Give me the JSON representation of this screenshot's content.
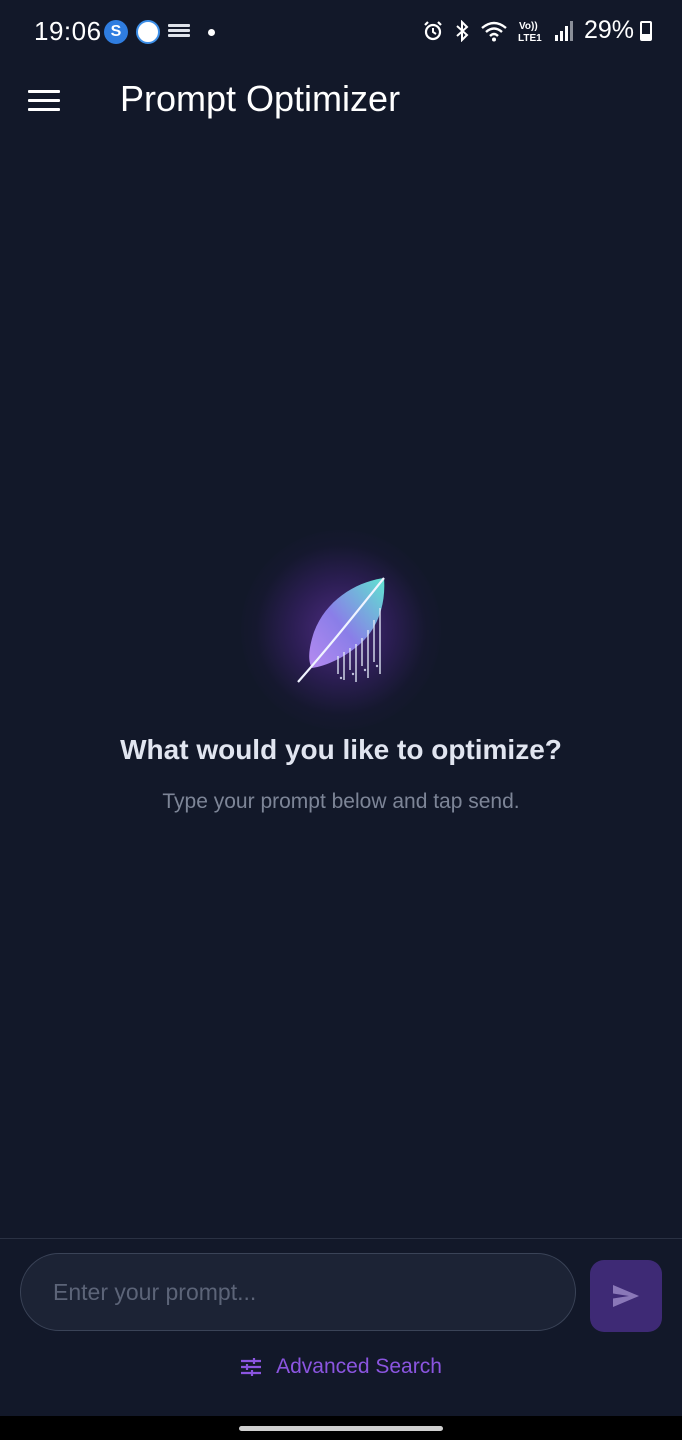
{
  "status_bar": {
    "time": "19:06",
    "notification_s_letter": "S",
    "battery": "29%",
    "network_label_top": "Vo))",
    "network_label_bottom": "LTE1"
  },
  "app_bar": {
    "title": "Prompt Optimizer"
  },
  "empty_state": {
    "title": "What would you like to optimize?",
    "subtitle": "Type your prompt below and tap send."
  },
  "composer": {
    "placeholder": "Enter your prompt...",
    "advanced_search_label": "Advanced Search"
  },
  "colors": {
    "background": "#121829",
    "accent": "#8b55e0",
    "send_button": "#3e2a75"
  },
  "icons": {
    "menu": "hamburger-menu-icon",
    "send": "send-icon",
    "advanced": "tune-sliders-icon",
    "logo": "feather-icon"
  }
}
